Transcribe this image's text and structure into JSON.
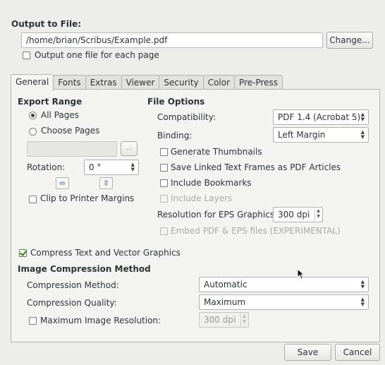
{
  "output": {
    "title": "Output to File:",
    "path": "/home/brian/Scribus/Example.pdf",
    "change_label": "Change...",
    "one_file_per_page_label": "Output one file for each page",
    "one_file_per_page_checked": false
  },
  "tabs": [
    {
      "label": "General",
      "active": true
    },
    {
      "label": "Fonts"
    },
    {
      "label": "Extras"
    },
    {
      "label": "Viewer"
    },
    {
      "label": "Security"
    },
    {
      "label": "Color"
    },
    {
      "label": "Pre-Press"
    }
  ],
  "export_range": {
    "title": "Export Range",
    "all_pages_label": "All Pages",
    "choose_pages_label": "Choose Pages",
    "selected": "All Pages",
    "pages_field_value": "",
    "browse_label": "...",
    "rotation_label": "Rotation:",
    "rotation_value": "0 °",
    "clip_label": "Clip to Printer Margins",
    "clip_checked": false
  },
  "file_options": {
    "title": "File Options",
    "compatibility_label": "Compatibility:",
    "compatibility_value": "PDF 1.4 (Acrobat 5)",
    "binding_label": "Binding:",
    "binding_value": "Left Margin",
    "generate_thumbnails_label": "Generate Thumbnails",
    "save_linked_label": "Save Linked Text Frames as PDF Articles",
    "include_bookmarks_label": "Include Bookmarks",
    "include_layers_label": "Include Layers",
    "resolution_label": "Resolution for EPS Graphics:",
    "resolution_value": "300 dpi",
    "embed_label": "Embed PDF & EPS files (EXPERIMENTAL)"
  },
  "compress": {
    "compress_text_label": "Compress Text and Vector Graphics",
    "compress_text_checked": true,
    "image_title": "Image Compression Method",
    "method_label": "Compression Method:",
    "method_value": "Automatic",
    "quality_label": "Compression Quality:",
    "quality_value": "Maximum",
    "max_res_label": "Maximum Image Resolution:",
    "max_res_value": "300 dpi"
  },
  "footer": {
    "save_label": "Save",
    "cancel_label": "Cancel"
  }
}
